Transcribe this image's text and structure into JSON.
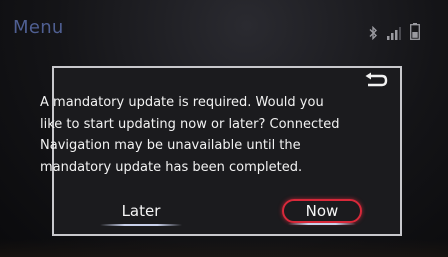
{
  "header": {
    "title": "Menu",
    "icons": [
      "bluetooth-icon",
      "signal-icon",
      "battery-icon"
    ]
  },
  "dialog": {
    "back_icon": "back-arrow-icon",
    "message": "A mandatory update is required. Would you like to start updating now or later? Connected Navigation may be unavailable until the mandatory update has been completed.",
    "buttons": {
      "later": "Later",
      "now": "Now"
    }
  },
  "colors": {
    "title": "#4f5f92",
    "focus_ring": "#d8293a",
    "text": "#f2f2f2"
  }
}
